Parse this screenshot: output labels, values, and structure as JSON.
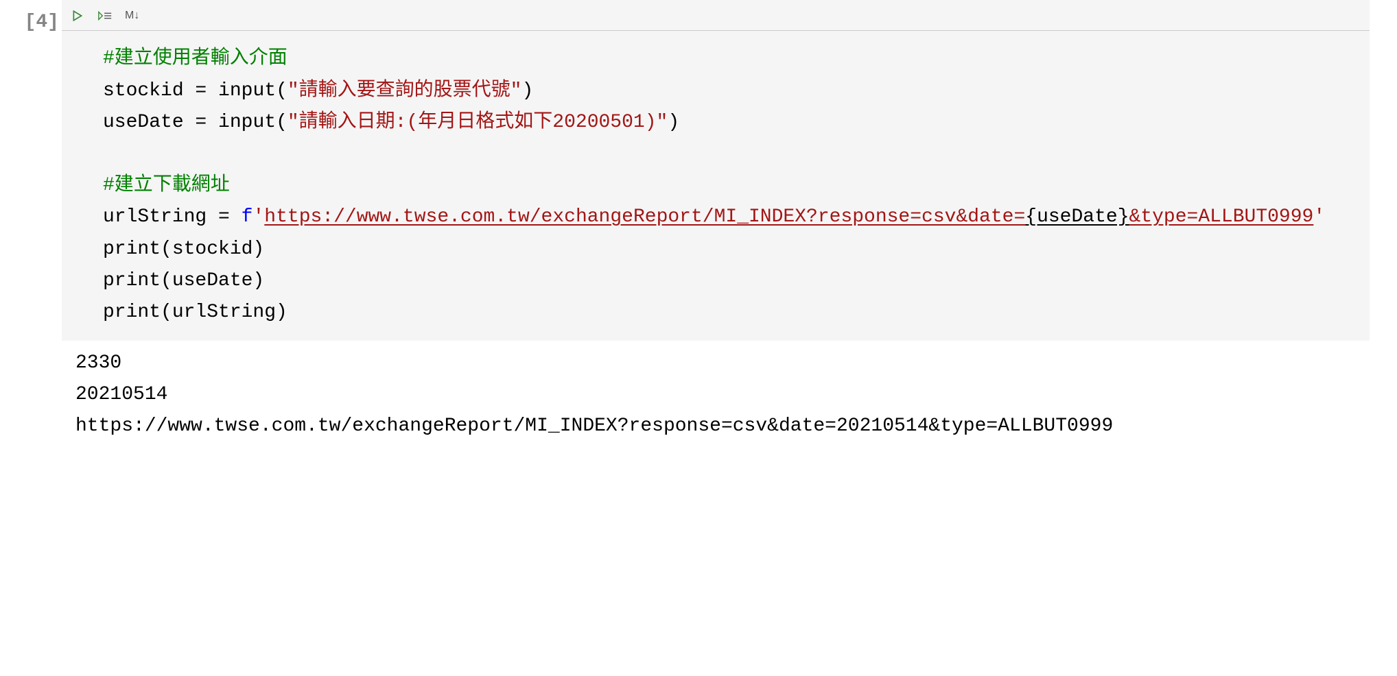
{
  "cell": {
    "prompt": "[4]",
    "toolbar": {
      "markdown_label": "M↓"
    },
    "code": {
      "comment1": "#建立使用者輸入介面",
      "line2": {
        "var": "stockid",
        "eq": " = ",
        "fn": "input",
        "paren_open": "(",
        "str": "\"請輸入要查詢的股票代號\"",
        "paren_close": ")"
      },
      "line3": {
        "var": "useDate",
        "eq": " = ",
        "fn": "input",
        "paren_open": "(",
        "str": "\"請輸入日期:(年月日格式如下20200501)\"",
        "paren_close": ")"
      },
      "comment2": "#建立下載網址",
      "line6": {
        "var": "urlString",
        "eq": " = ",
        "f": "f",
        "q1": "'",
        "url1": "https://www.twse.com.tw/exchangeReport/MI_INDEX?response=csv&date=",
        "interp": "{useDate}",
        "url2": "&type=ALLBUT0999",
        "q2": "'"
      },
      "line7": "print(stockid)",
      "line8": "print(useDate)",
      "line9": "print(urlString)"
    },
    "output": {
      "line1": "2330",
      "line2": "20210514",
      "line3": "https://www.twse.com.tw/exchangeReport/MI_INDEX?response=csv&date=20210514&type=ALLBUT0999"
    }
  }
}
